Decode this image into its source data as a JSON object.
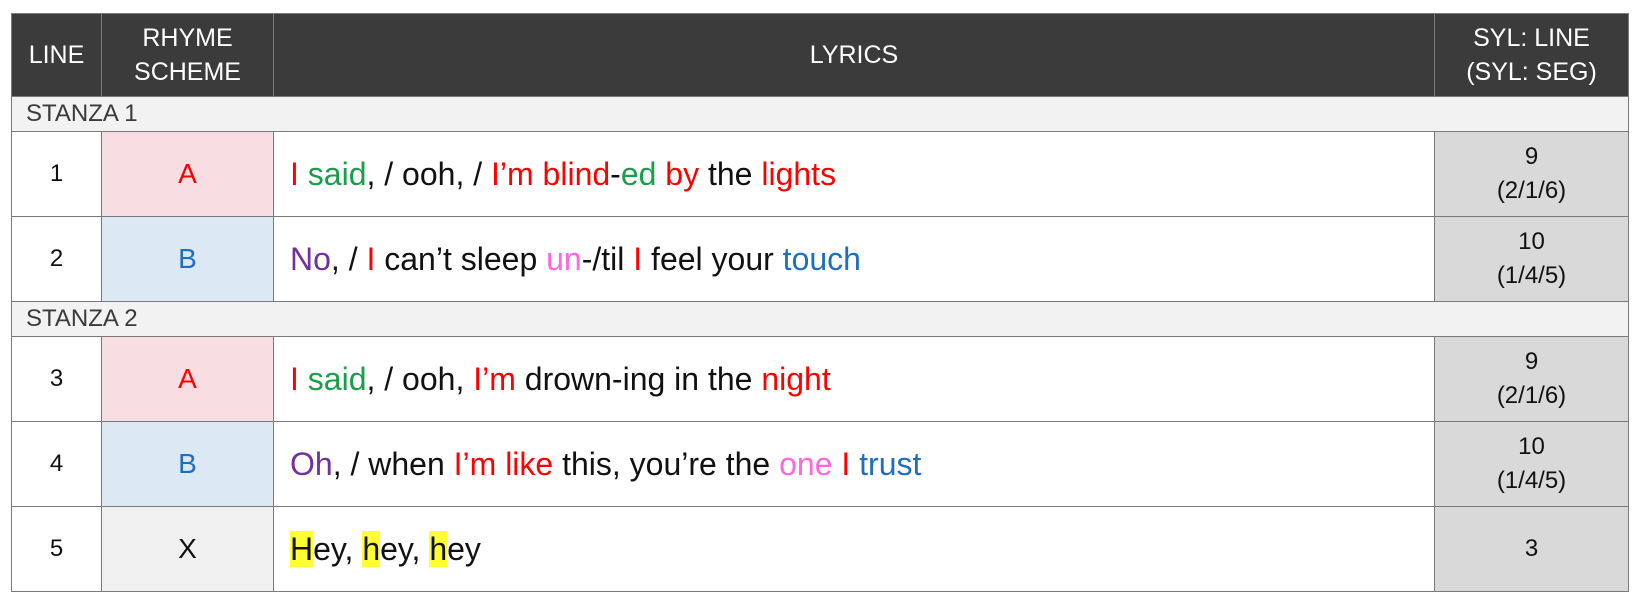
{
  "header": {
    "line": "LINE",
    "rhyme_1": "RHYME",
    "rhyme_2": "SCHEME",
    "lyrics": "LYRICS",
    "syl_1": "SYL: LINE",
    "syl_2": "(SYL: SEG)"
  },
  "colors": {
    "header_bg": "#3b3b3b",
    "rhyme_a_bg": "#f8dde3",
    "rhyme_b_bg": "#dde8f5",
    "syllable_bg": "#d9d9d9",
    "red": "#ff0000",
    "green": "#1a9e4a",
    "purple": "#7030a0",
    "pink": "#ff66e0",
    "blue": "#1f6fbd",
    "highlight": "#ffff33"
  },
  "stanzas": [
    {
      "label": "STANZA 1",
      "rows": [
        {
          "line": "1",
          "rhyme": "A",
          "rhyme_color": "red",
          "segments": [
            {
              "t": "I",
              "c": "red"
            },
            {
              "t": " ",
              "c": "black"
            },
            {
              "t": "said",
              "c": "green"
            },
            {
              "t": ", / ooh, / ",
              "c": "black"
            },
            {
              "t": "I’m blind",
              "c": "red"
            },
            {
              "t": "-",
              "c": "black"
            },
            {
              "t": "ed",
              "c": "green"
            },
            {
              "t": " ",
              "c": "black"
            },
            {
              "t": "by",
              "c": "red"
            },
            {
              "t": " the ",
              "c": "black"
            },
            {
              "t": "lights",
              "c": "red"
            }
          ],
          "syl": "9",
          "syl_seg": "(2/1/6)"
        },
        {
          "line": "2",
          "rhyme": "B",
          "rhyme_color": "blue",
          "segments": [
            {
              "t": "No",
              "c": "purple"
            },
            {
              "t": ", / ",
              "c": "black"
            },
            {
              "t": "I",
              "c": "red"
            },
            {
              "t": " can’t sleep ",
              "c": "black"
            },
            {
              "t": "un",
              "c": "pink"
            },
            {
              "t": "-/til ",
              "c": "black"
            },
            {
              "t": "I",
              "c": "red"
            },
            {
              "t": " feel your ",
              "c": "black"
            },
            {
              "t": "touch",
              "c": "blue"
            }
          ],
          "syl": "10",
          "syl_seg": "(1/4/5)"
        }
      ]
    },
    {
      "label": "STANZA 2",
      "rows": [
        {
          "line": "3",
          "rhyme": "A",
          "rhyme_color": "red",
          "segments": [
            {
              "t": "I",
              "c": "red"
            },
            {
              "t": " ",
              "c": "black"
            },
            {
              "t": "said",
              "c": "green"
            },
            {
              "t": ", / ooh, ",
              "c": "black"
            },
            {
              "t": "I’m",
              "c": "red"
            },
            {
              "t": " drown-ing in the ",
              "c": "black"
            },
            {
              "t": "night",
              "c": "red"
            }
          ],
          "syl": "9",
          "syl_seg": "(2/1/6)"
        },
        {
          "line": "4",
          "rhyme": "B",
          "rhyme_color": "blue",
          "segments": [
            {
              "t": "Oh",
              "c": "purple"
            },
            {
              "t": ", / when ",
              "c": "black"
            },
            {
              "t": "I’m like",
              "c": "red"
            },
            {
              "t": " this, you’re the ",
              "c": "black"
            },
            {
              "t": "one",
              "c": "pink"
            },
            {
              "t": " ",
              "c": "black"
            },
            {
              "t": "I",
              "c": "red"
            },
            {
              "t": " ",
              "c": "black"
            },
            {
              "t": "trust",
              "c": "blue"
            }
          ],
          "syl": "10",
          "syl_seg": "(1/4/5)"
        },
        {
          "line": "5",
          "rhyme": "X",
          "rhyme_color": "black",
          "segments": [
            {
              "t": "H",
              "c": "black",
              "hl": true
            },
            {
              "t": "ey, ",
              "c": "black"
            },
            {
              "t": "h",
              "c": "black",
              "hl": true
            },
            {
              "t": "ey, ",
              "c": "black"
            },
            {
              "t": "h",
              "c": "black",
              "hl": true
            },
            {
              "t": "ey",
              "c": "black"
            }
          ],
          "syl": "3",
          "syl_seg": ""
        }
      ]
    }
  ]
}
